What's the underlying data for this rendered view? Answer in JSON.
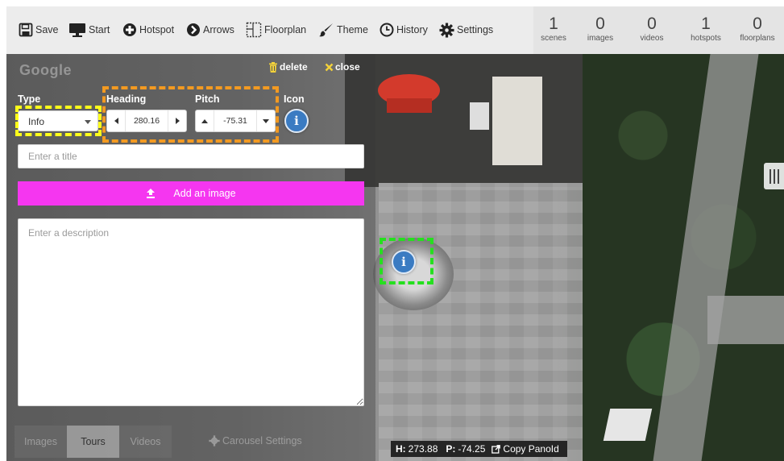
{
  "toolbar": {
    "items": [
      {
        "label": "Save",
        "icon": "save-icon"
      },
      {
        "label": "Start",
        "icon": "monitor-icon"
      },
      {
        "label": "Hotspot",
        "icon": "plus-circle-icon"
      },
      {
        "label": "Arrows",
        "icon": "arrow-circle-icon"
      },
      {
        "label": "Floorplan",
        "icon": "floorplan-icon"
      },
      {
        "label": "Theme",
        "icon": "brush-icon"
      },
      {
        "label": "History",
        "icon": "clock-icon"
      },
      {
        "label": "Settings",
        "icon": "gear-icon"
      }
    ],
    "stats": [
      {
        "value": "1",
        "label": "scenes"
      },
      {
        "value": "0",
        "label": "images"
      },
      {
        "value": "0",
        "label": "videos"
      },
      {
        "value": "1",
        "label": "hotspots"
      },
      {
        "value": "0",
        "label": "floorplans"
      }
    ]
  },
  "viewer": {
    "watermark": "Google"
  },
  "editor": {
    "delete_label": "delete",
    "close_label": "close",
    "type_label": "Type",
    "type_value": "Info",
    "heading_label": "Heading",
    "heading_value": "280.16",
    "pitch_label": "Pitch",
    "pitch_value": "-75.31",
    "icon_label": "Icon",
    "icon_glyph": "i",
    "title_placeholder": "Enter a title",
    "add_image_label": "Add an image",
    "description_placeholder": "Enter a description"
  },
  "hotspot_marker": {
    "glyph": "i"
  },
  "bottom": {
    "tabs": [
      {
        "label": "Images",
        "active": false
      },
      {
        "label": "Tours",
        "active": true
      },
      {
        "label": "Videos",
        "active": false
      }
    ],
    "carousel_label": "Carousel Settings"
  },
  "status": {
    "h_label": "H:",
    "h_value": "273.88",
    "p_label": "P:",
    "p_value": "-74.25",
    "copy_label": "Copy PanoId"
  },
  "colors": {
    "accent_magenta": "#f536f0",
    "icon_blue": "#3a7bc2",
    "highlight_yellow": "#ffff1a",
    "highlight_orange": "#f39a21",
    "highlight_green": "#25e01f"
  }
}
